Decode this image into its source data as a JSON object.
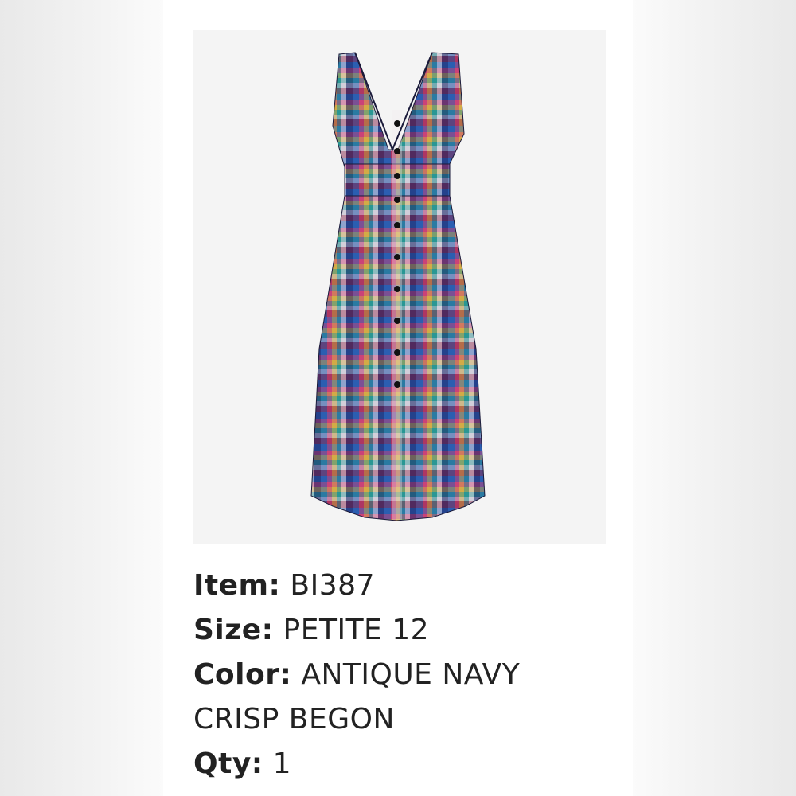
{
  "details": {
    "item_label": "Item:",
    "item_value": "BI387",
    "size_label": "Size:",
    "size_value": "PETITE 12",
    "color_label": "Color:",
    "color_value_line1": "ANTIQUE NAVY",
    "color_value_line2": "CRISP BEGON",
    "qty_label": "Qty:",
    "qty_value": "1"
  },
  "colors": {
    "plaid_navy": "#1e2a6b",
    "plaid_blue": "#2d63b8",
    "plaid_pink": "#e0457a",
    "plaid_red": "#c92a3f",
    "plaid_yellow": "#f0c040",
    "plaid_teal": "#2aa59a",
    "plaid_white": "#f2ecee"
  }
}
